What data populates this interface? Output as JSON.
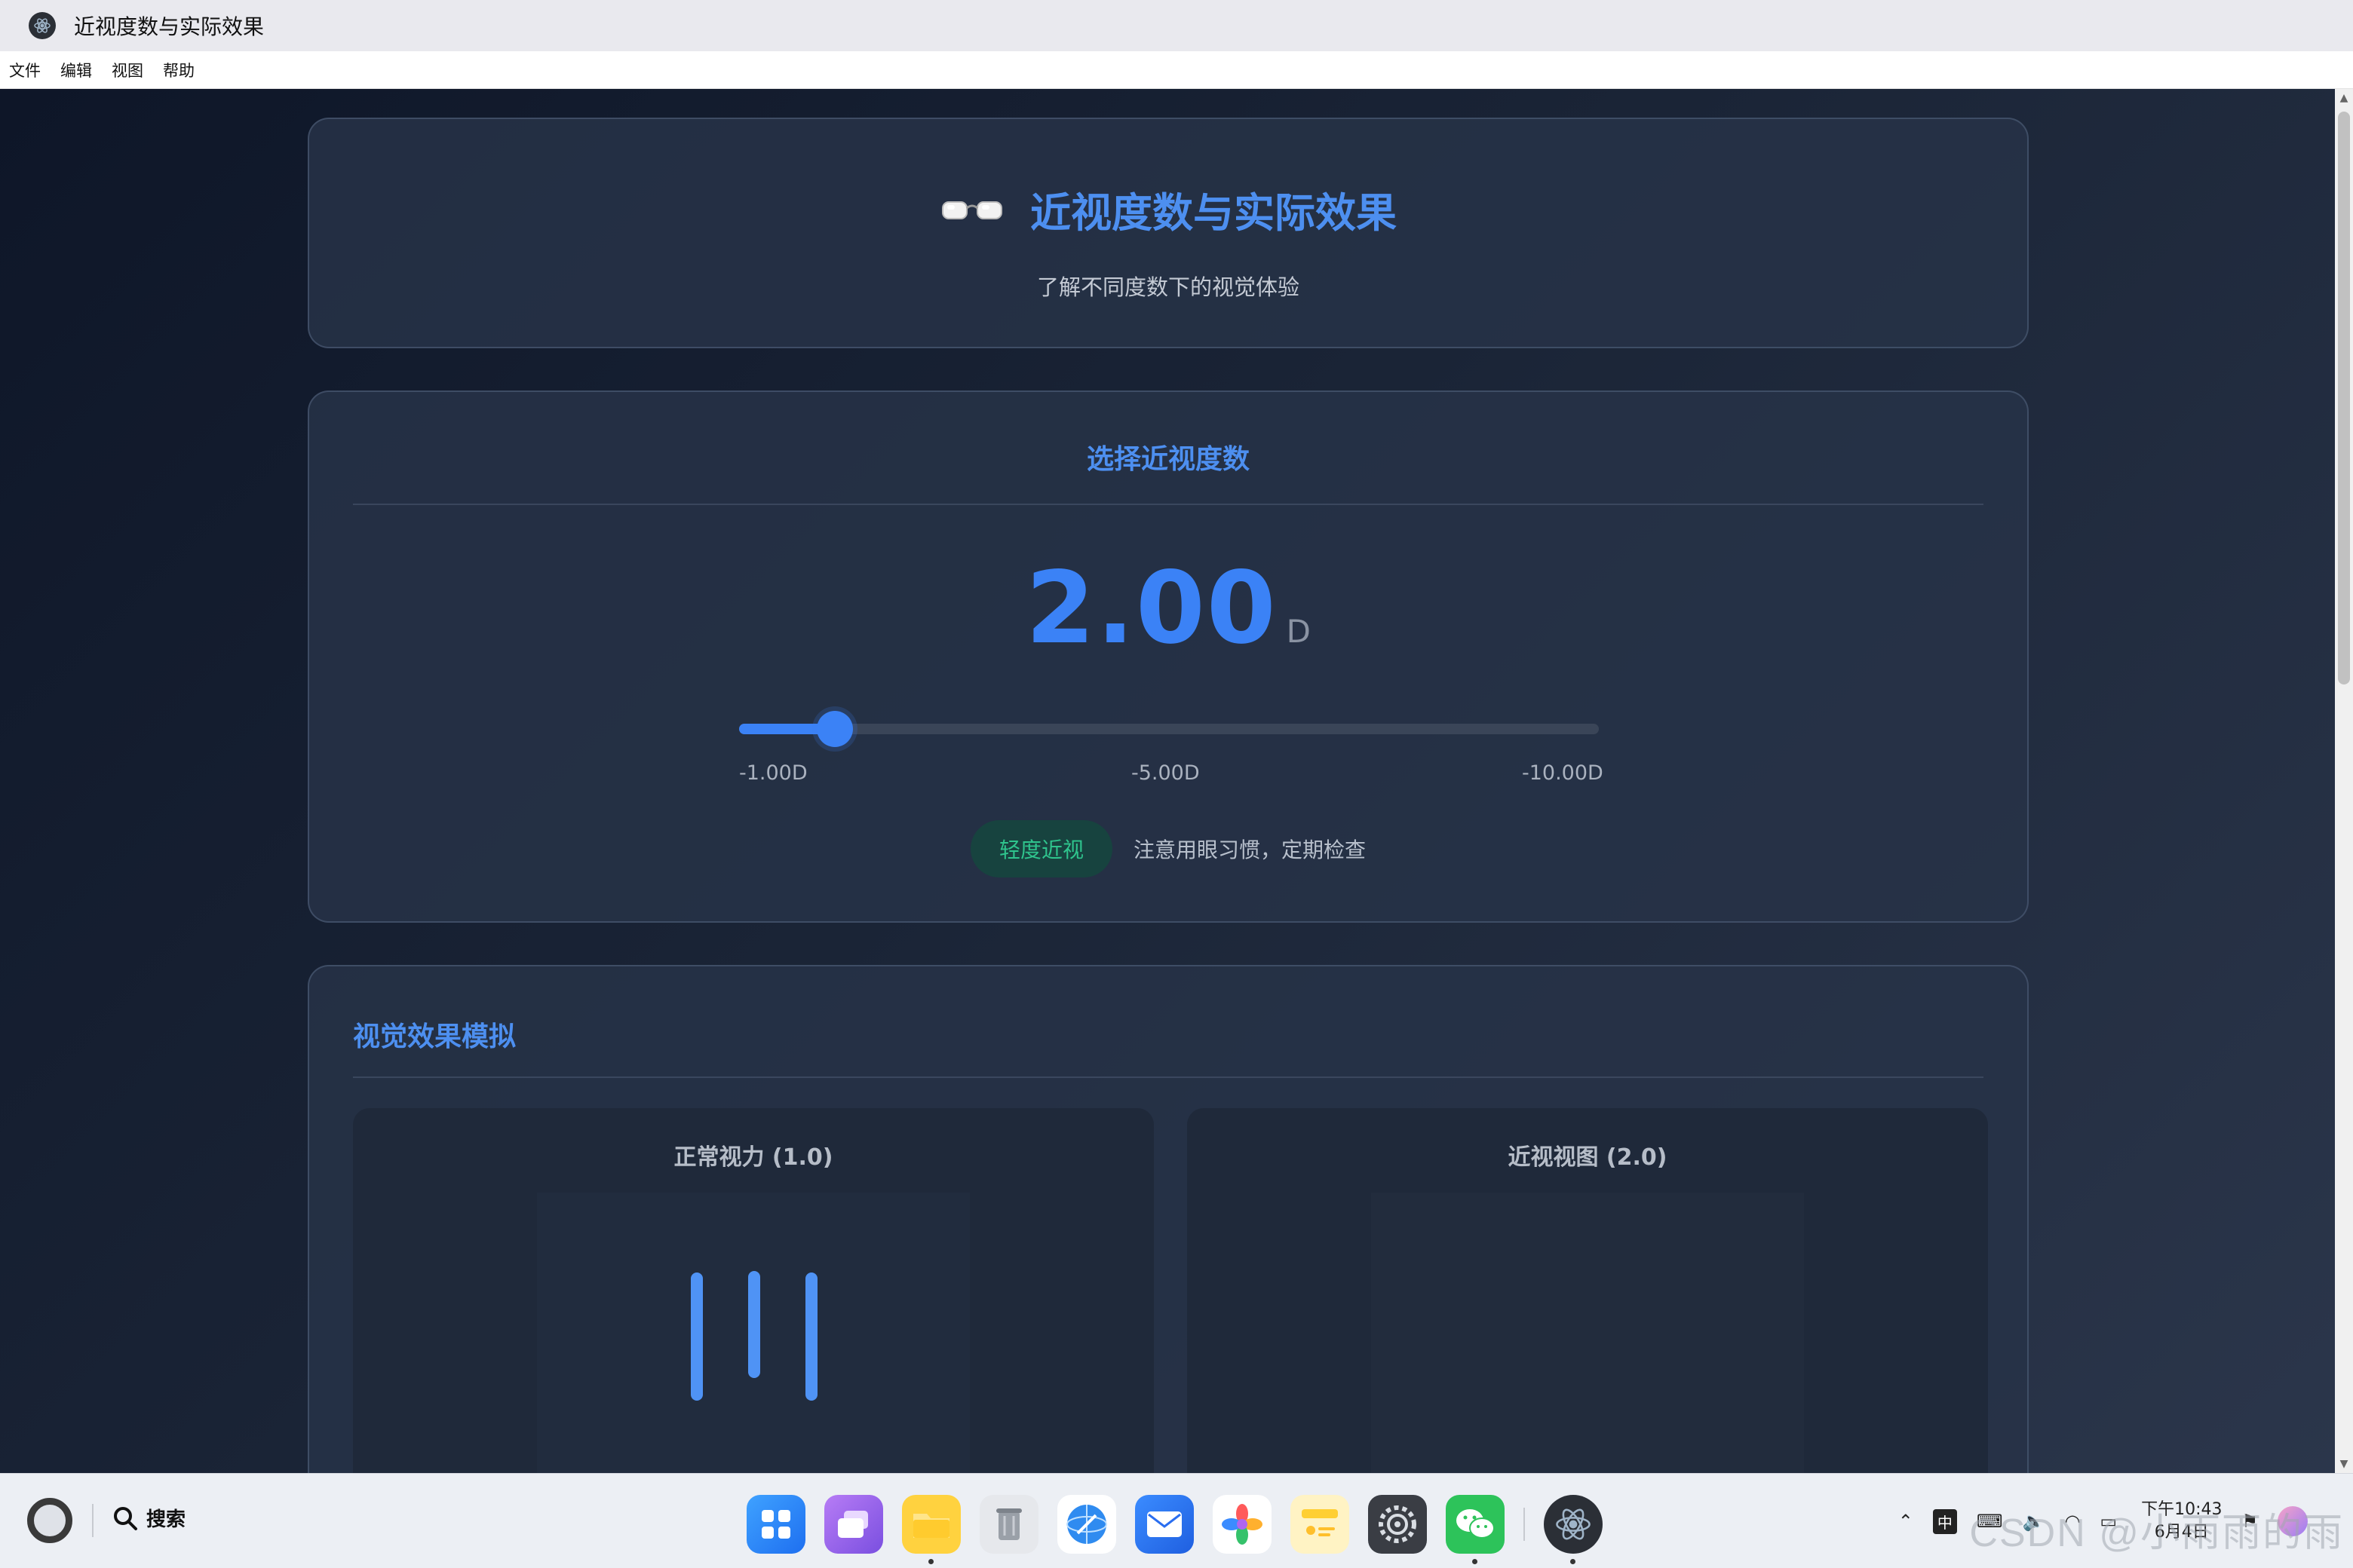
{
  "window": {
    "title": "近视度数与实际效果"
  },
  "menu": [
    "文件",
    "编辑",
    "视图",
    "帮助"
  ],
  "header": {
    "title": "近视度数与实际效果",
    "subtitle": "了解不同度数下的视觉体验",
    "icon": "glasses-icon"
  },
  "selector": {
    "title": "选择近视度数",
    "value": "2.00",
    "unit": "D",
    "slider_fraction": 0.111,
    "ticks": [
      "-1.00D",
      "-5.00D",
      "-10.00D"
    ],
    "badge": "轻度近视",
    "advice": "注意用眼习惯，定期检查",
    "accent": "#3b82f6",
    "badge_color": "#2fc48d"
  },
  "simulation": {
    "title": "视觉效果模拟",
    "normal_title": "正常视力 (1.0)",
    "myopia_title": "近视视图 (2.0)"
  },
  "taskbar": {
    "search_label": "搜索",
    "apps": [
      "launcher-icon",
      "multitask-icon",
      "files-icon",
      "trash-icon",
      "browser-icon",
      "mail-icon",
      "photos-icon",
      "notes-icon",
      "settings-icon",
      "wechat-icon",
      "electron-app-icon"
    ],
    "tray": {
      "ime": "中"
    },
    "clock_time": "下午10:43",
    "clock_date": "6月4日",
    "watermark": "CSDN @小雨雨的雨"
  }
}
